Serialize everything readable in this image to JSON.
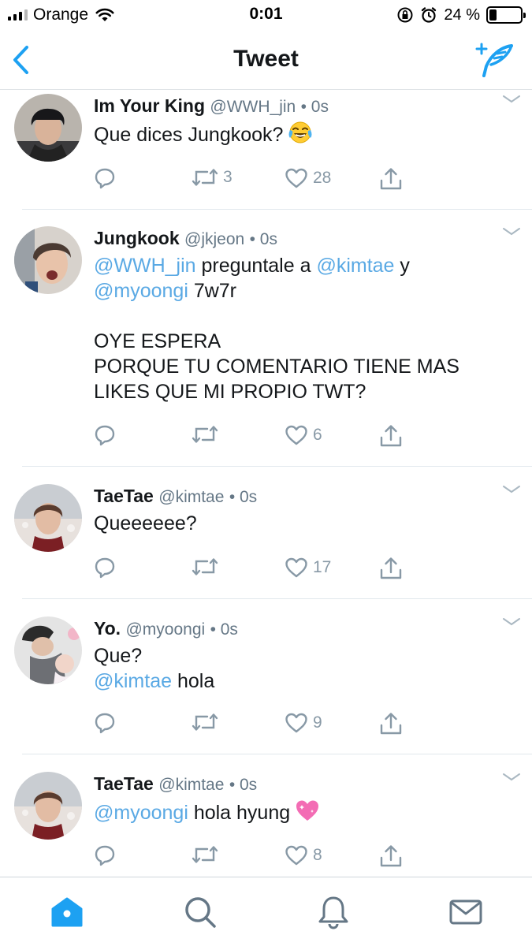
{
  "status_bar": {
    "carrier": "Orange",
    "time": "0:01",
    "battery_text": "24 %",
    "battery_level": 0.24,
    "signal_bars_on": 3,
    "signal_bars_total": 4
  },
  "nav": {
    "title": "Tweet",
    "back_icon": "chevron-left-icon",
    "compose_icon": "compose-feather-icon",
    "accent_color": "#1da1f2"
  },
  "tweets": [
    {
      "name": "Im Your King",
      "handle": "@WWH_jin",
      "time": "• 0s",
      "lines": [
        [
          {
            "t": "Que dices Jungkook?"
          }
        ]
      ],
      "emoji": "face-with-tears-of-joy",
      "retweets": "3",
      "likes": "28"
    },
    {
      "name": "Jungkook",
      "handle": "@jkjeon",
      "time": "• 0s",
      "lines": [
        [
          {
            "m": "@WWH_jin"
          },
          {
            "t": " preguntale a "
          },
          {
            "m": "@kimtae"
          },
          {
            "t": " y"
          }
        ],
        [
          {
            "m": "@myoongi"
          },
          {
            "t": " 7w7r"
          }
        ],
        [],
        [
          {
            "t": "OYE ESPERA"
          }
        ],
        [
          {
            "t": "PORQUE TU COMENTARIO TIENE MAS"
          }
        ],
        [
          {
            "t": "LIKES QUE MI PROPIO TWT?"
          }
        ]
      ],
      "retweets": "",
      "likes": "6"
    },
    {
      "name": "TaeTae",
      "handle": "@kimtae",
      "time": "• 0s",
      "lines": [
        [
          {
            "t": "Queeeeee?"
          }
        ]
      ],
      "retweets": "",
      "likes": "17"
    },
    {
      "name": "Yo.",
      "handle": "@myoongi",
      "time": "• 0s",
      "lines": [
        [
          {
            "t": "Que?"
          }
        ],
        [
          {
            "m": "@kimtae"
          },
          {
            "t": " hola"
          }
        ]
      ],
      "retweets": "",
      "likes": "9"
    },
    {
      "name": "TaeTae",
      "handle": "@kimtae",
      "time": "• 0s",
      "lines": [
        [
          {
            "m": "@myoongi"
          },
          {
            "t": " hola hyung"
          }
        ]
      ],
      "emoji": "pink-sparkling-heart",
      "retweets": "",
      "likes": "8"
    }
  ],
  "tab_bar": {
    "items": [
      "home-icon",
      "search-icon",
      "notifications-bell-icon",
      "messages-envelope-icon"
    ],
    "active": "home-icon",
    "active_color": "#1da1f2",
    "inactive_color": "#657786"
  }
}
